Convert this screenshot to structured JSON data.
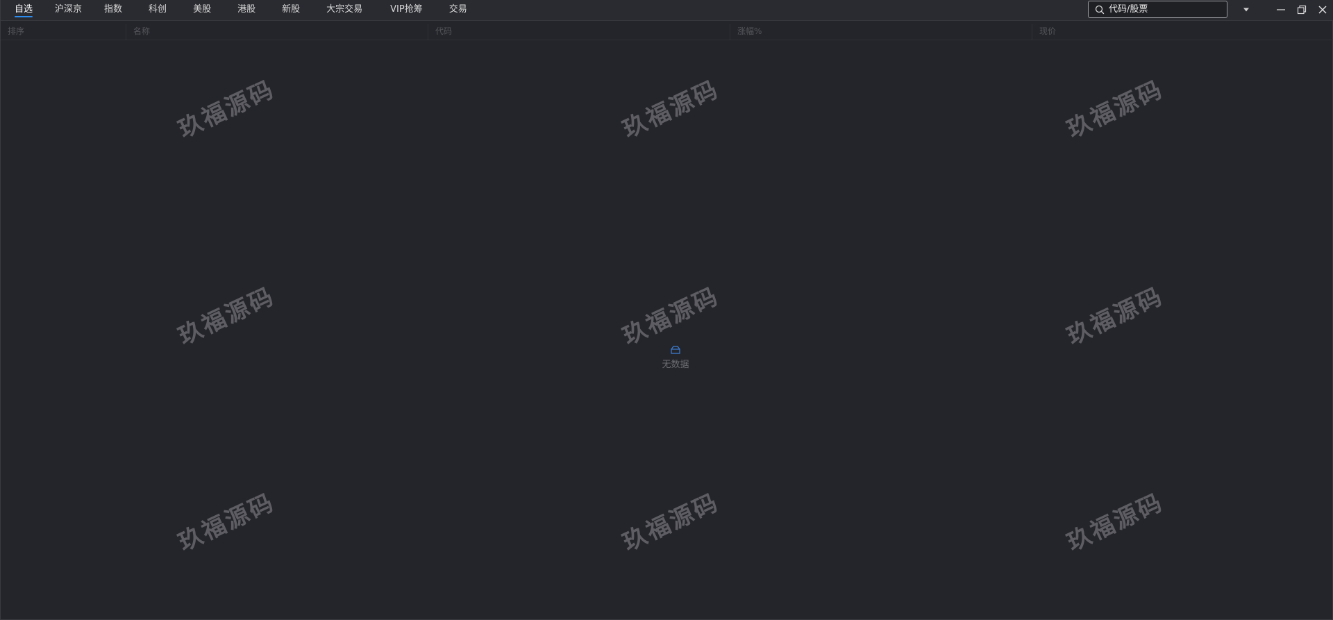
{
  "tabs": [
    {
      "label": "自选",
      "active": true
    },
    {
      "label": "沪深京",
      "active": false
    },
    {
      "label": "指数",
      "active": false
    },
    {
      "label": "科创",
      "active": false
    },
    {
      "label": "美股",
      "active": false
    },
    {
      "label": "港股",
      "active": false
    },
    {
      "label": "新股",
      "active": false
    },
    {
      "label": "大宗交易",
      "active": false
    },
    {
      "label": "VIP抢筹",
      "active": false
    },
    {
      "label": "交易",
      "active": false
    }
  ],
  "search": {
    "placeholder": "代码/股票",
    "value": ""
  },
  "table": {
    "columns": [
      "排序",
      "名称",
      "代码",
      "涨幅%",
      "现价"
    ],
    "rows": []
  },
  "empty_state": {
    "text": "无数据"
  },
  "watermark": {
    "text": "玖福源码"
  },
  "colors": {
    "background": "#24252a",
    "accent": "#2d8cf0",
    "header_text": "#54555a"
  },
  "icons": {
    "search": "search-icon",
    "dropdown": "caret-down-icon",
    "minimize": "minimize-icon",
    "restore": "restore-icon",
    "close": "close-icon",
    "empty": "empty-box-icon"
  }
}
